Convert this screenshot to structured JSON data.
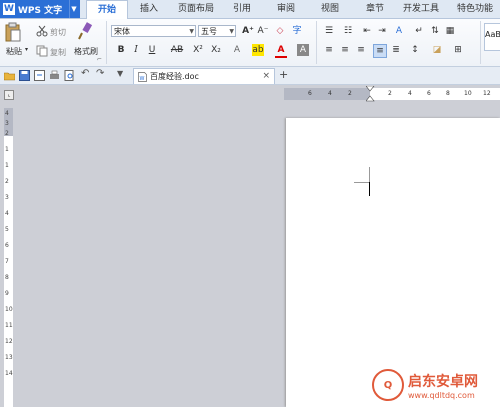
{
  "app": {
    "title": "WPS 文字"
  },
  "menu_tabs": [
    "开始",
    "插入",
    "页面布局",
    "引用",
    "审阅",
    "视图",
    "章节",
    "开发工具",
    "特色功能"
  ],
  "active_tab": "开始",
  "ribbon": {
    "paste": "粘贴",
    "cut": "剪切",
    "copy": "复制",
    "format_painter": "格式刷",
    "font_name": "宋体",
    "font_size": "五号",
    "style_preview": "AaB"
  },
  "document": {
    "tab_name": "百度经验.doc"
  },
  "ruler": {
    "horizontal_ticks": [
      "6",
      "4",
      "2",
      "2",
      "4",
      "6",
      "8",
      "10",
      "12"
    ],
    "vertical_ticks": [
      "4",
      "3",
      "2",
      "1",
      "1",
      "2",
      "3",
      "4",
      "5",
      "6",
      "7",
      "8",
      "9",
      "10",
      "11",
      "12",
      "13",
      "14"
    ]
  },
  "watermark": {
    "brand": "启东安卓网",
    "url": "www.qdltdq.com",
    "logo_text": "Q"
  },
  "colors": {
    "accent": "#2b6fd6",
    "watermark": "#e05a3a"
  }
}
